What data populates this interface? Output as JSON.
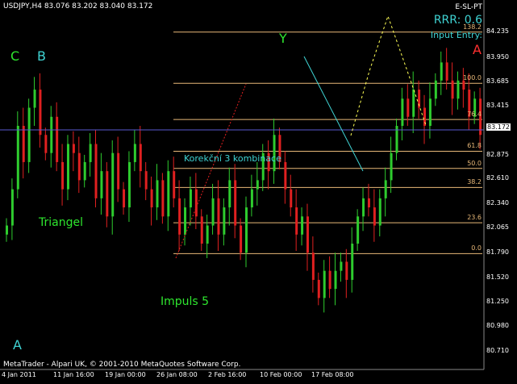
{
  "header": {
    "symbol_line": "USDJPY,H4  83.076 83.202 83.040 83.172",
    "corner_label": "E-SL-PT",
    "rrr": "RRR: 0.6",
    "input_entry": "Input Entry:"
  },
  "annotations": {
    "wave_c": "C",
    "wave_b": "B",
    "wave_y": "Y",
    "wave_a_top": "A",
    "wave_a_bottom": "A",
    "triangel": "Triangel",
    "impuls": "Impuls 5",
    "korekcni": "Korekční 3 kombinace"
  },
  "fibo_levels": [
    "138.2",
    "100.0",
    "76.4",
    "61.8",
    "50.0",
    "38.2",
    "23.6",
    "0.0"
  ],
  "price_axis": [
    "84.235",
    "83.950",
    "83.685",
    "83.415",
    "83.172",
    "82.875",
    "82.610",
    "82.340",
    "82.065",
    "81.790",
    "81.520",
    "81.250",
    "80.980",
    "80.710"
  ],
  "time_axis": [
    "4 Jan 2011",
    "11 Jan 16:00",
    "19 Jan 00:00",
    "26 Jan 08:00",
    "2 Feb 16:00",
    "10 Feb 00:00",
    "17 Feb 08:00"
  ],
  "footer": {
    "copyright": "MetaTrader - Alpari UK, © 2001-2010 MetaQuotes Software Corp."
  },
  "colors": {
    "background": "#000000",
    "bull": "#2ecc2e",
    "bear": "#e02020",
    "fibo": "#e8b878",
    "projection": "#ffff55",
    "trendline": "#3fd3d3",
    "current_price_line": "#5a5ad0"
  },
  "chart_data": {
    "type": "candlestick",
    "symbol": "USDJPY",
    "timeframe": "H4",
    "last_bar": {
      "open": 83.076,
      "high": 83.202,
      "low": 83.04,
      "close": 83.172
    },
    "current_price": 83.172,
    "y_range": [
      80.6,
      84.5
    ],
    "x_labels": [
      "4 Jan 2011",
      "11 Jan 16:00",
      "19 Jan 00:00",
      "26 Jan 08:00",
      "2 Feb 16:00",
      "10 Feb 00:00",
      "17 Feb 08:00"
    ],
    "fibonacci": [
      {
        "level": "138.2",
        "price": 84.235
      },
      {
        "level": "100.0",
        "price": 83.67
      },
      {
        "level": "76.4",
        "price": 83.27
      },
      {
        "level": "61.8",
        "price": 82.92
      },
      {
        "level": "50.0",
        "price": 82.73
      },
      {
        "level": "38.2",
        "price": 82.52
      },
      {
        "level": "23.6",
        "price": 82.13
      },
      {
        "level": "0.0",
        "price": 81.79
      }
    ],
    "closes": [
      82.1,
      82.5,
      83.2,
      82.8,
      83.4,
      83.6,
      83.1,
      82.9,
      83.3,
      82.8,
      82.5,
      83.0,
      82.9,
      82.6,
      82.8,
      83.0,
      82.4,
      82.7,
      82.2,
      82.9,
      82.5,
      82.3,
      82.8,
      83.0,
      82.7,
      82.5,
      82.3,
      82.6,
      82.2,
      82.7,
      82.4,
      82.0,
      82.3,
      82.5,
      82.2,
      81.9,
      82.1,
      82.4,
      82.0,
      82.3,
      82.6,
      82.1,
      81.8,
      82.3,
      82.5,
      82.6,
      82.9,
      82.7,
      83.1,
      82.8,
      82.5,
      82.3,
      82.0,
      82.2,
      81.8,
      81.5,
      81.3,
      81.6,
      81.4,
      81.6,
      81.7,
      81.5,
      81.9,
      82.2,
      82.4,
      82.3,
      82.1,
      82.4,
      82.6,
      82.9,
      83.2,
      83.5,
      83.3,
      83.6,
      83.4,
      83.2,
      83.5,
      83.7,
      83.9,
      83.7,
      83.5,
      83.7,
      83.6,
      83.3,
      83.5,
      83.1
    ]
  }
}
